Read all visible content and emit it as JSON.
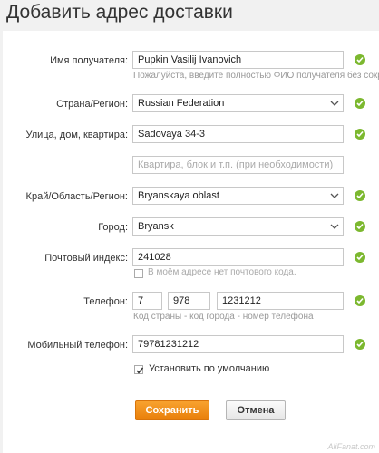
{
  "page": {
    "title": "Добавить адрес доставки"
  },
  "form": {
    "recipient": {
      "label": "Имя получателя:",
      "value": "Pupkin Vasilij Ivanovich",
      "hint": "Пожалуйста, введите полностью ФИО получателя без сокра"
    },
    "country": {
      "label": "Страна/Регион:",
      "value": "Russian Federation"
    },
    "street": {
      "label": "Улица, дом, квартира:",
      "value": "Sadovaya 34-3"
    },
    "apartment": {
      "placeholder": "Квартира, блок и т.п. (при необходимости)"
    },
    "region": {
      "label": "Край/Область/Регион:",
      "value": "Bryanskaya oblast"
    },
    "city": {
      "label": "Город:",
      "value": "Bryansk"
    },
    "postal": {
      "label": "Почтовый индекс:",
      "value": "241028",
      "no_postal_label": "В моём адресе нет почтового кода."
    },
    "phone": {
      "label": "Телефон:",
      "country_code": "7",
      "city_code": "978",
      "number": "1231212",
      "hint": "Код страны - код города - номер телефона"
    },
    "mobile": {
      "label": "Мобильный телефон:",
      "value": "79781231212"
    },
    "default": {
      "label": "Установить по умолчанию",
      "checked": true
    },
    "buttons": {
      "save": "Сохранить",
      "cancel": "Отмена"
    }
  },
  "watermark": "AliFanat.com",
  "colors": {
    "ok_green": "#7cb82f",
    "save_orange": "#f08c1c"
  }
}
